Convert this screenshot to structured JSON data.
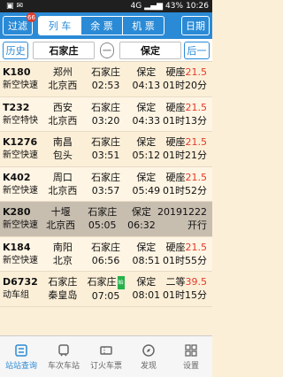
{
  "status_bar": {
    "signal": "4G",
    "battery": "43%",
    "time": "10:26"
  },
  "toolbar": {
    "filter_label": "过滤",
    "filter_badge": "66",
    "tabs": [
      {
        "label": "列 车"
      },
      {
        "label": "余 票"
      },
      {
        "label": "机 票"
      }
    ],
    "date_label": "日期"
  },
  "route": {
    "history_label": "历史",
    "from_station": "石家庄",
    "swap_label": "一",
    "to_station": "保定",
    "next_label": "后一"
  },
  "trains": [
    {
      "number": "K180",
      "type": "新空快速",
      "from": "郑州",
      "origin": "北京西",
      "dep_station": "石家庄",
      "dep_time": "02:53",
      "arr_station": "保定",
      "arr_time": "04:13",
      "seat": "硬座",
      "price": "21.5",
      "duration": "01时20分"
    },
    {
      "number": "T232",
      "type": "新空特快",
      "from": "西安",
      "origin": "北京西",
      "dep_station": "石家庄",
      "dep_time": "03:20",
      "arr_station": "保定",
      "arr_time": "04:33",
      "seat": "硬座",
      "price": "21.5",
      "duration": "01时13分"
    },
    {
      "number": "K1276",
      "type": "新空快速",
      "from": "南昌",
      "origin": "包头",
      "dep_station": "石家庄",
      "dep_time": "03:51",
      "arr_station": "保定",
      "arr_time": "05:12",
      "seat": "硬座",
      "price": "21.5",
      "duration": "01时21分"
    },
    {
      "number": "K402",
      "type": "新空快速",
      "from": "周口",
      "origin": "北京西",
      "dep_station": "石家庄",
      "dep_time": "03:57",
      "arr_station": "保定",
      "arr_time": "05:49",
      "seat": "硬座",
      "price": "21.5",
      "duration": "01时52分"
    },
    {
      "number": "K280",
      "type": "新空快速",
      "from": "十堰",
      "origin": "北京西",
      "dep_station": "石家庄",
      "dep_time": "05:05",
      "arr_station": "保定",
      "arr_time": "06:32",
      "seat": "20191222",
      "price": "",
      "duration": "开行"
    },
    {
      "number": "K184",
      "type": "新空快速",
      "from": "南阳",
      "origin": "北京",
      "dep_station": "石家庄",
      "dep_time": "06:56",
      "arr_station": "保定",
      "arr_time": "08:51",
      "seat": "硬座",
      "price": "21.5",
      "duration": "01时55分"
    },
    {
      "number": "D6732",
      "type": "动车组",
      "from": "石家庄",
      "origin": "秦皇岛",
      "dep_station": "石家庄",
      "dep_time": "07:05",
      "arr_station": "保定",
      "arr_time": "08:01",
      "seat": "二等",
      "price": "39.5",
      "duration": "01时15分"
    }
  ],
  "train7_tag": "始",
  "bottom_nav": [
    {
      "label": "站站查询",
      "icon": "search-icon"
    },
    {
      "label": "车次车站",
      "icon": "train-icon"
    },
    {
      "label": "订火车票",
      "icon": "ticket-icon"
    },
    {
      "label": "发现",
      "icon": "compass-icon"
    },
    {
      "label": "设置",
      "icon": "settings-icon"
    }
  ],
  "colors": {
    "accent": "#2a8ad6",
    "price": "#e23b2b",
    "row_bg": "#fcefd8"
  }
}
